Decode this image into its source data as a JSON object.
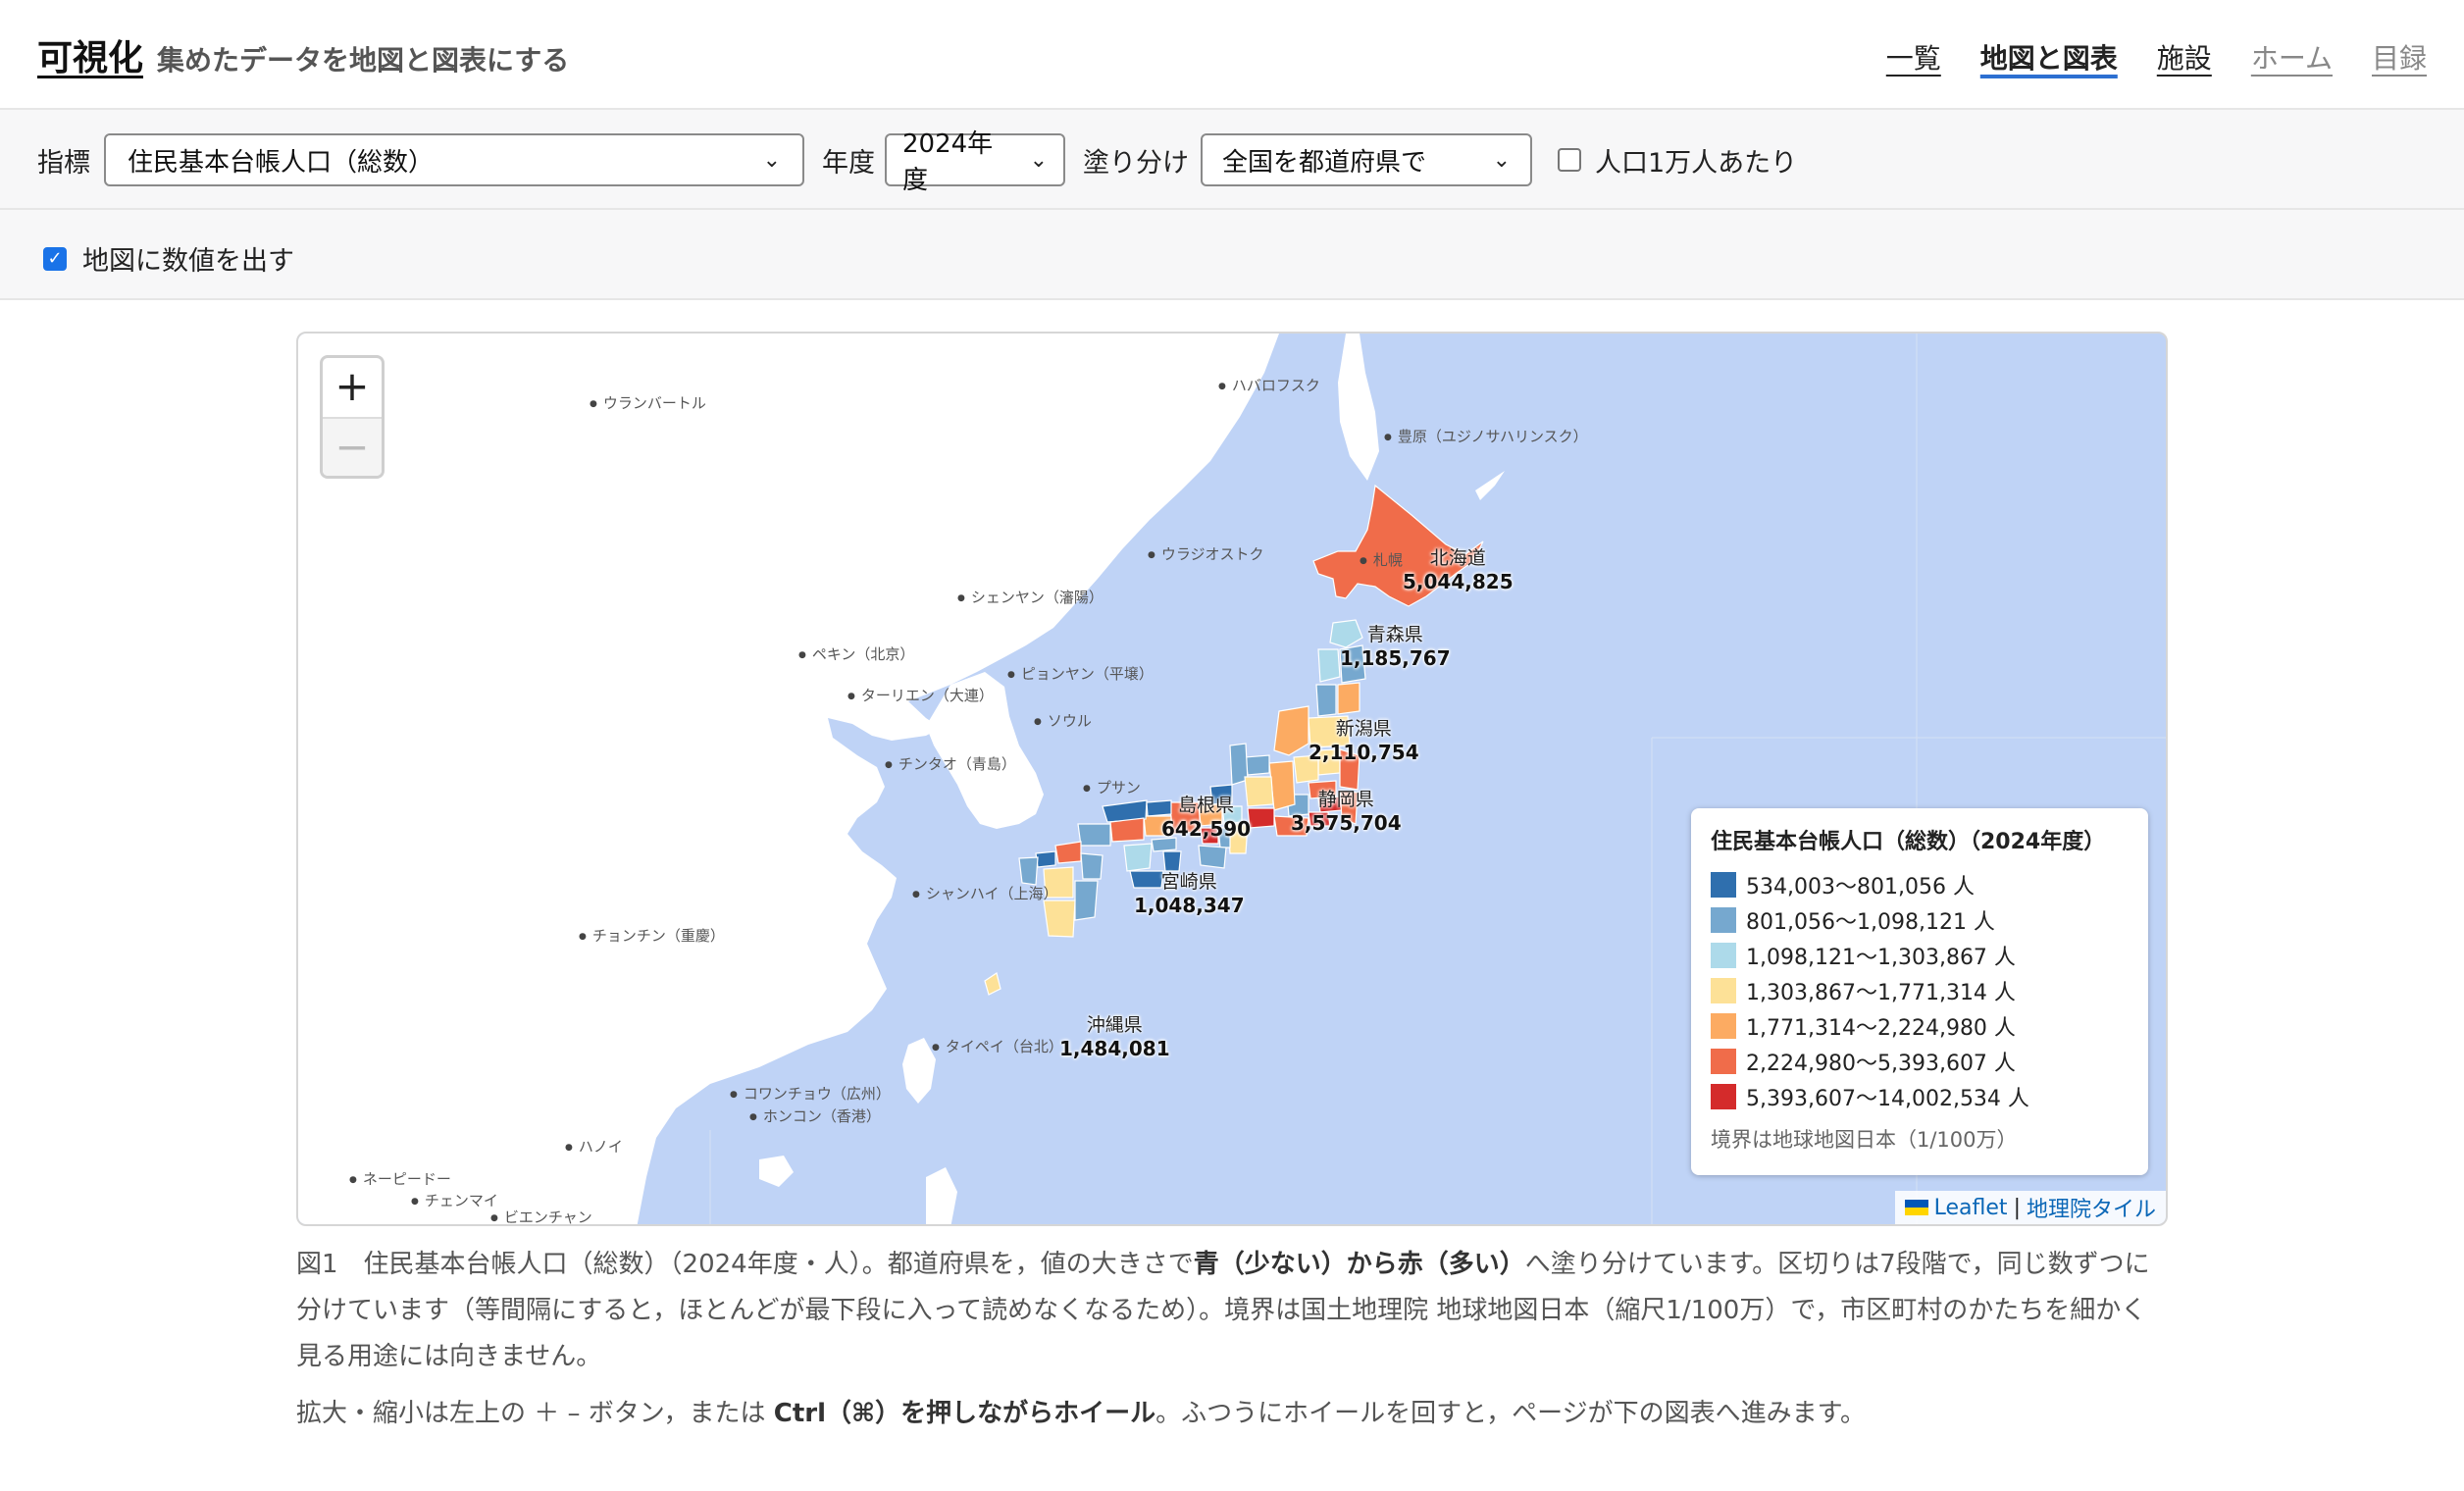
{
  "header": {
    "title": "可視化",
    "subtitle": "集めたデータを地図と図表にする",
    "nav": [
      {
        "label": "一覧"
      },
      {
        "label": "地図と図表"
      },
      {
        "label": "施設"
      },
      {
        "label": "ホーム"
      },
      {
        "label": "目録"
      }
    ]
  },
  "controls": {
    "indicator_label": "指標",
    "indicator_value": "住民基本台帳人口（総数）",
    "year_label": "年度",
    "year_value": "2024年度",
    "paint_label": "塗り分け",
    "paint_value": "全国を都道府県で",
    "per_capita_label": "人口1万人あたり",
    "per_capita_checked": false,
    "show_values_label": "地図に数値を出す",
    "show_values_checked": true
  },
  "map": {
    "zoom_in": "+",
    "zoom_out": "−",
    "cities": [
      "ウランバートル",
      "ハバロフスク",
      "豊原（ユジノサハリンスク）",
      "ウラジオストク",
      "シェンヤン（瀋陽）",
      "ペキン（北京）",
      "ピョンヤン（平壌）",
      "ターリエン（大連）",
      "ソウル",
      "チンタオ（青島）",
      "プサン",
      "シャンハイ（上海）",
      "チョンチン（重慶）",
      "タイペイ（台北）",
      "コワンチョウ（広州）",
      "ホンコン（香港）",
      "ハノイ",
      "ネーピードー",
      "チェンマイ",
      "ビエンチャン",
      "札幌"
    ],
    "prefectures": [
      {
        "name": "北海道",
        "value": "5,044,825"
      },
      {
        "name": "青森県",
        "value": "1,185,767"
      },
      {
        "name": "新潟県",
        "value": "2,110,754"
      },
      {
        "name": "静岡県",
        "value": "3,575,704"
      },
      {
        "name": "島根県",
        "value": "642,590"
      },
      {
        "name": "宮崎県",
        "value": "1,048,347"
      },
      {
        "name": "沖縄県",
        "value": "1,484,081"
      }
    ],
    "legend": {
      "title": "住民基本台帳人口（総数）（2024年度）",
      "items": [
        {
          "label": "534,003〜801,056 人",
          "color": "#2f6fae"
        },
        {
          "label": "801,056〜1,098,121 人",
          "color": "#76a8cf"
        },
        {
          "label": "1,098,121〜1,303,867 人",
          "color": "#addaea"
        },
        {
          "label": "1,303,867〜1,771,314 人",
          "color": "#fde197"
        },
        {
          "label": "1,771,314〜2,224,980 人",
          "color": "#fcab62"
        },
        {
          "label": "2,224,980〜5,393,607 人",
          "color": "#f06c4a"
        },
        {
          "label": "5,393,607〜14,002,534 人",
          "color": "#d42b2b"
        }
      ],
      "note": "境界は地球地図日本（1/100万）"
    },
    "attribution": {
      "leaflet": "Leaflet",
      "sep": "|",
      "tiles": "地理院タイル"
    }
  },
  "caption": {
    "p1_a": "図1　住民基本台帳人口（総数）（2024年度・人）。都道府県を，値の大きさで",
    "p1_b": "青（少ない）から赤（多い）",
    "p1_c": "へ塗り分けています。区切りは7段階で，同じ数ずつに分けています（等間隔にすると，ほとんどが最下段に入って読めなくなるため）。境界は国土地理院 地球地図日本（縮尺1/100万）で，市区町村のかたちを細かく見る用途には向きません。",
    "p2_a": "拡大・縮小は左上の ＋ – ボタン，または",
    "p2_b": "Ctrl（⌘）を押しながらホイール",
    "p2_c": "。ふつうにホイールを回すと，ページが下の図表へ進みます。"
  },
  "colors": {
    "sea": "#bfd3f6",
    "land": "#ffffff",
    "accent": "#2c6fd1"
  }
}
